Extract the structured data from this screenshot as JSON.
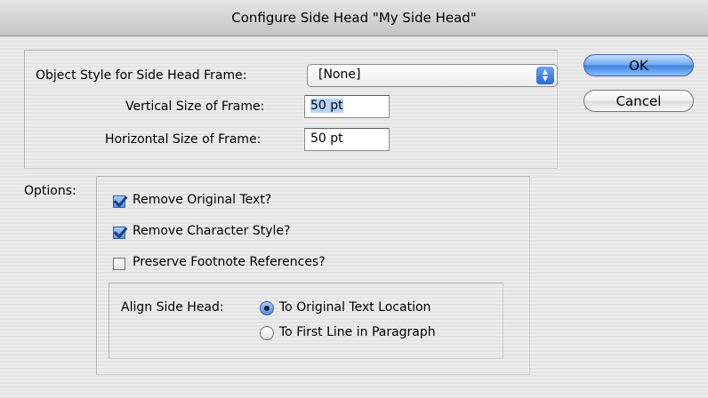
{
  "dialog": {
    "title": "Configure Side Head \"My Side Head\""
  },
  "frame": {
    "object_style_label": "Object Style for Side Head Frame:",
    "object_style_value": "[None]",
    "vertical_label": "Vertical Size of Frame:",
    "vertical_value": "50 pt",
    "horizontal_label": "Horizontal Size of Frame:",
    "horizontal_value": "50 pt"
  },
  "buttons": {
    "ok": "OK",
    "cancel": "Cancel"
  },
  "options": {
    "label": "Options:",
    "checkboxes": [
      {
        "label": "Remove Original Text?",
        "checked": true
      },
      {
        "label": "Remove Character Style?",
        "checked": true
      },
      {
        "label": "Preserve Footnote References?",
        "checked": false
      }
    ],
    "align": {
      "label": "Align Side Head:",
      "choices": [
        {
          "label": "To Original Text Location",
          "selected": true
        },
        {
          "label": "To First Line in Paragraph",
          "selected": false
        }
      ]
    }
  },
  "icons": {
    "popup_arrows": "updown-arrows-icon",
    "checkbox_mark": "checkmark-icon"
  },
  "colors": {
    "default_button": "#3b82e0",
    "selection_highlight": "#b5d5ff"
  }
}
